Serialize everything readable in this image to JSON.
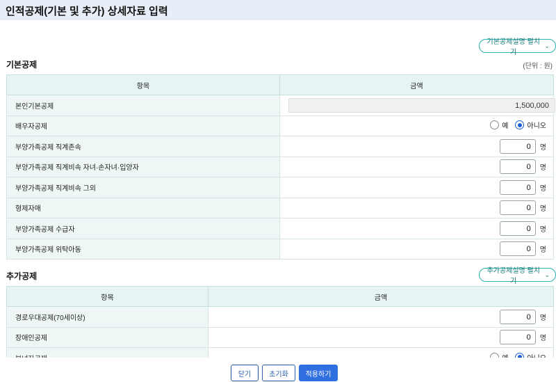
{
  "title": "인적공제(기본 및 추가) 상세자료 입력",
  "basic": {
    "section_title": "기본공제",
    "toggle_label": "기본공제설명 펼치기",
    "unit_note": "(단위 : 원)",
    "col_item": "항목",
    "col_amount": "금액",
    "rows": [
      {
        "label": "본인기본공제",
        "value": "1,500,000"
      },
      {
        "label": "배우자공제",
        "radio_yes": "예",
        "radio_no": "아니오",
        "selected": "아니오"
      },
      {
        "label": "부양가족공제 직계존속",
        "value": "0",
        "unit": "명"
      },
      {
        "label": "부양가족공제 직계비속 자녀·손자녀·입양자",
        "value": "0",
        "unit": "명"
      },
      {
        "label": "부양가족공제 직계비속 그외",
        "value": "0",
        "unit": "명"
      },
      {
        "label": "형제자매",
        "value": "0",
        "unit": "명"
      },
      {
        "label": "부양가족공제 수급자",
        "value": "0",
        "unit": "명"
      },
      {
        "label": "부양가족공제 위탁아동",
        "value": "0",
        "unit": "명"
      }
    ]
  },
  "additional": {
    "section_title": "추가공제",
    "toggle_label": "추가공제설명 펼치기",
    "col_item": "항목",
    "col_amount": "금액",
    "rows": [
      {
        "label": "경로우대공제(70세이상)",
        "value": "0",
        "unit": "명"
      },
      {
        "label": "장애인공제",
        "value": "0",
        "unit": "명"
      },
      {
        "label": "부녀자공제",
        "radio_yes": "예",
        "radio_no": "아니오",
        "selected": "아니오"
      }
    ]
  },
  "footer": {
    "close_label": "닫기",
    "reset_label": "초기화",
    "apply_label": "적용하기"
  }
}
